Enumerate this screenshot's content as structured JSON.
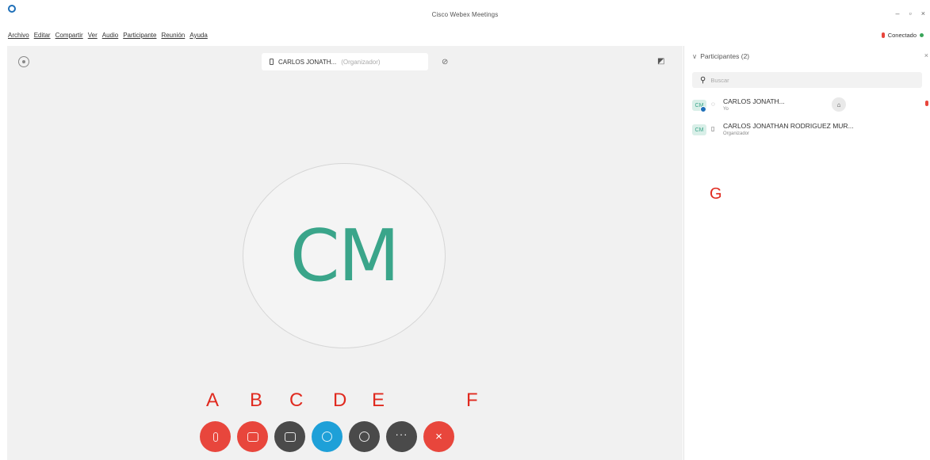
{
  "window": {
    "title": "Cisco Webex Meetings",
    "controls": [
      "–",
      "▫",
      "×"
    ]
  },
  "menu": {
    "items": [
      "Archivo",
      "Editar",
      "Compartir",
      "Ver",
      "Audio",
      "Participante",
      "Reunión",
      "Ayuda"
    ]
  },
  "status": {
    "connection": "Conectado"
  },
  "stage": {
    "speaker_name": "CARLOS JONATH...",
    "speaker_role": "(Organizador)",
    "avatar_initials": "CM",
    "avatar_color": "#3aa58a"
  },
  "controls": {
    "labels": [
      "A",
      "B",
      "C",
      "D",
      "E",
      "F"
    ],
    "more_symbol": "···",
    "end_symbol": "×"
  },
  "participants_panel": {
    "title": "Participantes (2)",
    "search_placeholder": "Buscar",
    "participants": [
      {
        "initials": "CM",
        "name": "CARLOS JONATH...",
        "subtitle": "Yo"
      },
      {
        "initials": "CM",
        "name": "CARLOS JONATHAN RODRIGUEZ MUR...",
        "subtitle": "Organizador"
      }
    ],
    "label": "G"
  },
  "colors": {
    "red": "#e8463c",
    "dark": "#4a4a4a",
    "blue": "#1ea0d8",
    "annotation": "#e02a1f"
  }
}
